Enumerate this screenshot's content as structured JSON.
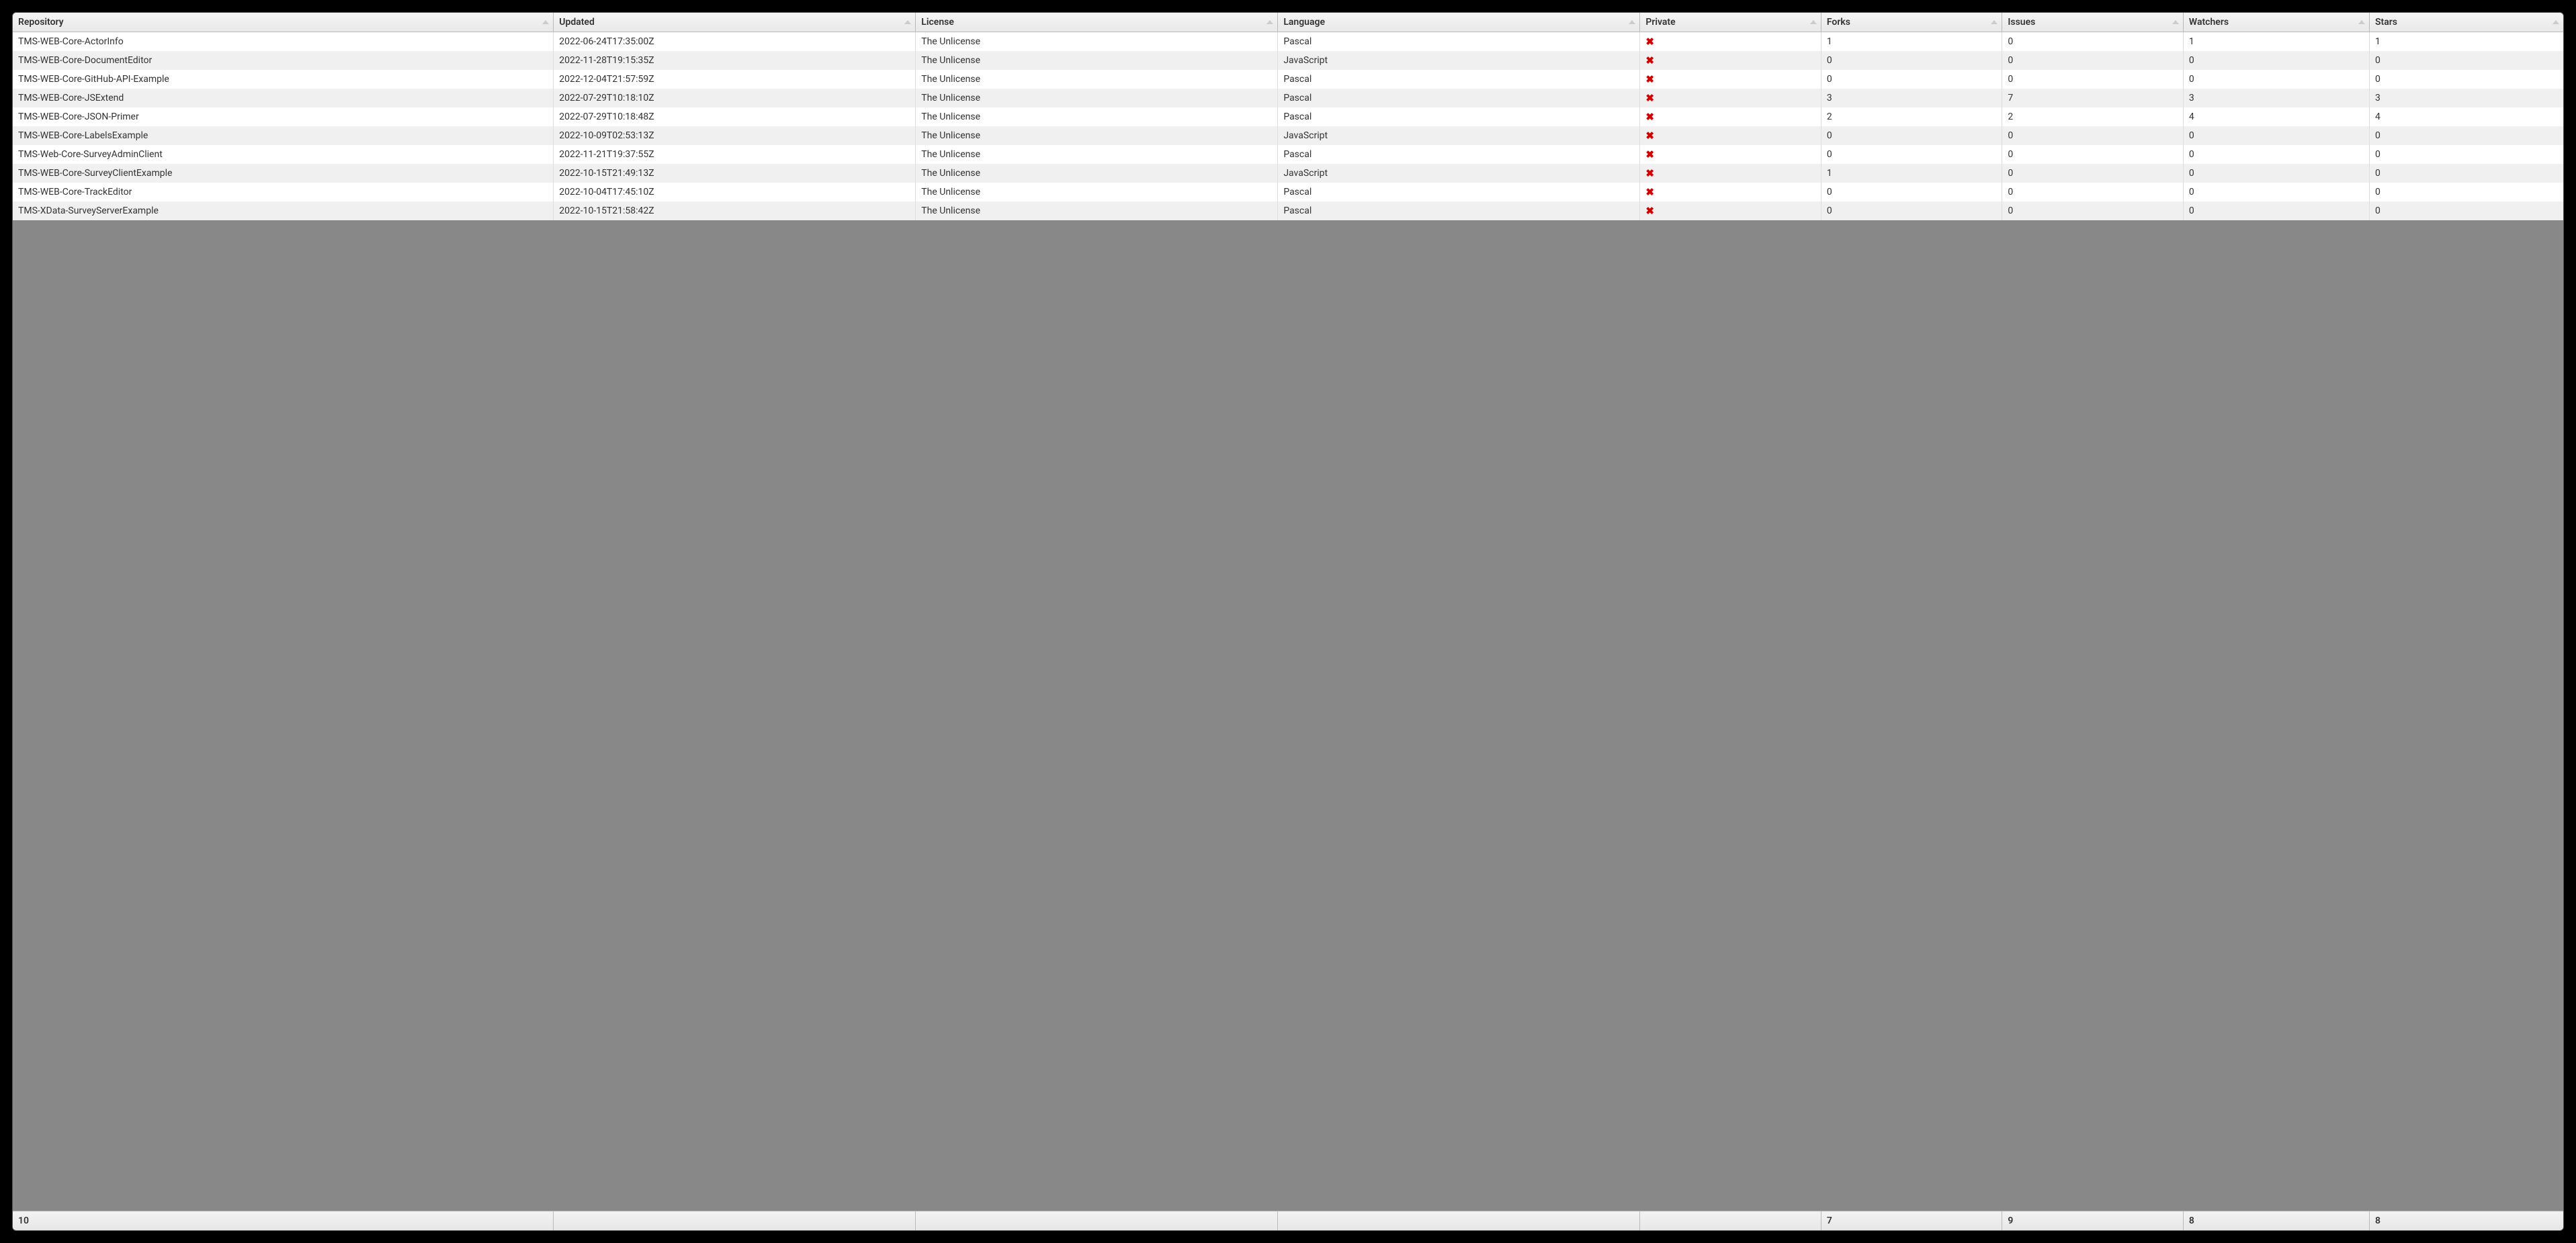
{
  "columns": [
    {
      "key": "repo",
      "label": "Repository",
      "cssClass": "col-repo"
    },
    {
      "key": "updated",
      "label": "Updated",
      "cssClass": "col-updated"
    },
    {
      "key": "license",
      "label": "License",
      "cssClass": "col-license"
    },
    {
      "key": "language",
      "label": "Language",
      "cssClass": "col-language"
    },
    {
      "key": "private",
      "label": "Private",
      "cssClass": "col-private",
      "type": "bool"
    },
    {
      "key": "forks",
      "label": "Forks",
      "cssClass": "col-forks"
    },
    {
      "key": "issues",
      "label": "Issues",
      "cssClass": "col-issues"
    },
    {
      "key": "watchers",
      "label": "Watchers",
      "cssClass": "col-watchers"
    },
    {
      "key": "stars",
      "label": "Stars",
      "cssClass": "col-stars"
    }
  ],
  "rows": [
    {
      "repo": "TMS-WEB-Core-ActorInfo",
      "updated": "2022-06-24T17:35:00Z",
      "license": "The Unlicense",
      "language": "Pascal",
      "private": false,
      "forks": 1,
      "issues": 0,
      "watchers": 1,
      "stars": 1
    },
    {
      "repo": "TMS-WEB-Core-DocumentEditor",
      "updated": "2022-11-28T19:15:35Z",
      "license": "The Unlicense",
      "language": "JavaScript",
      "private": false,
      "forks": 0,
      "issues": 0,
      "watchers": 0,
      "stars": 0
    },
    {
      "repo": "TMS-WEB-Core-GitHub-API-Example",
      "updated": "2022-12-04T21:57:59Z",
      "license": "The Unlicense",
      "language": "Pascal",
      "private": false,
      "forks": 0,
      "issues": 0,
      "watchers": 0,
      "stars": 0
    },
    {
      "repo": "TMS-WEB-Core-JSExtend",
      "updated": "2022-07-29T10:18:10Z",
      "license": "The Unlicense",
      "language": "Pascal",
      "private": false,
      "forks": 3,
      "issues": 7,
      "watchers": 3,
      "stars": 3
    },
    {
      "repo": "TMS-WEB-Core-JSON-Primer",
      "updated": "2022-07-29T10:18:48Z",
      "license": "The Unlicense",
      "language": "Pascal",
      "private": false,
      "forks": 2,
      "issues": 2,
      "watchers": 4,
      "stars": 4
    },
    {
      "repo": "TMS-WEB-Core-LabelsExample",
      "updated": "2022-10-09T02:53:13Z",
      "license": "The Unlicense",
      "language": "JavaScript",
      "private": false,
      "forks": 0,
      "issues": 0,
      "watchers": 0,
      "stars": 0
    },
    {
      "repo": "TMS-Web-Core-SurveyAdminClient",
      "updated": "2022-11-21T19:37:55Z",
      "license": "The Unlicense",
      "language": "Pascal",
      "private": false,
      "forks": 0,
      "issues": 0,
      "watchers": 0,
      "stars": 0
    },
    {
      "repo": "TMS-WEB-Core-SurveyClientExample",
      "updated": "2022-10-15T21:49:13Z",
      "license": "The Unlicense",
      "language": "JavaScript",
      "private": false,
      "forks": 1,
      "issues": 0,
      "watchers": 0,
      "stars": 0
    },
    {
      "repo": "TMS-WEB-Core-TrackEditor",
      "updated": "2022-10-04T17:45:10Z",
      "license": "The Unlicense",
      "language": "Pascal",
      "private": false,
      "forks": 0,
      "issues": 0,
      "watchers": 0,
      "stars": 0
    },
    {
      "repo": "TMS-XData-SurveyServerExample",
      "updated": "2022-10-15T21:58:42Z",
      "license": "The Unlicense",
      "language": "Pascal",
      "private": false,
      "forks": 0,
      "issues": 0,
      "watchers": 0,
      "stars": 0
    }
  ],
  "footer": {
    "repo": "10",
    "updated": "",
    "license": "",
    "language": "",
    "private": "",
    "forks": "7",
    "issues": "9",
    "watchers": "8",
    "stars": "8"
  },
  "icons": {
    "false_mark": "✖"
  }
}
